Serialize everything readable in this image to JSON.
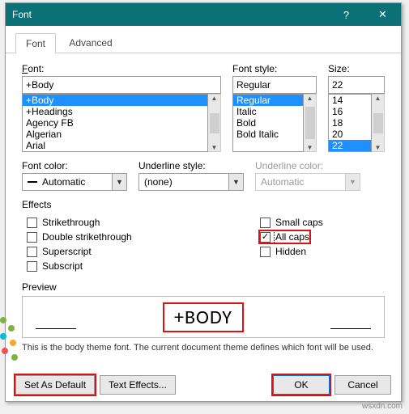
{
  "titlebar": {
    "title": "Font",
    "help": "?",
    "close": "✕"
  },
  "tabs": {
    "font": "Font",
    "advanced": "Advanced"
  },
  "labels": {
    "font": "Font:",
    "style": "Font style:",
    "size": "Size:",
    "fontcolor": "Font color:",
    "underlinestyle": "Underline style:",
    "underlinecolor": "Underline color:",
    "effects": "Effects",
    "preview": "Preview"
  },
  "values": {
    "font_input": "+Body",
    "style_input": "Regular",
    "size_input": "22",
    "font_color": "Automatic",
    "underline_style": "(none)",
    "underline_color": "Automatic"
  },
  "font_list": [
    "+Body",
    "+Headings",
    "Agency FB",
    "Algerian",
    "Arial"
  ],
  "style_list": [
    "Regular",
    "Italic",
    "Bold",
    "Bold Italic"
  ],
  "size_list": [
    "14",
    "16",
    "18",
    "20",
    "22"
  ],
  "effects": {
    "strike": "Strikethrough",
    "dstrike": "Double strikethrough",
    "superscript": "Superscript",
    "subscript": "Subscript",
    "smallcaps": "Small caps",
    "allcaps": "All caps",
    "hidden": "Hidden"
  },
  "preview_text": "+BODY",
  "hint": "This is the body theme font. The current document theme defines which font will be used.",
  "buttons": {
    "setdefault": "Set As Default",
    "texteffects": "Text Effects...",
    "ok": "OK",
    "cancel": "Cancel"
  },
  "watermark": "wsxdn.com"
}
